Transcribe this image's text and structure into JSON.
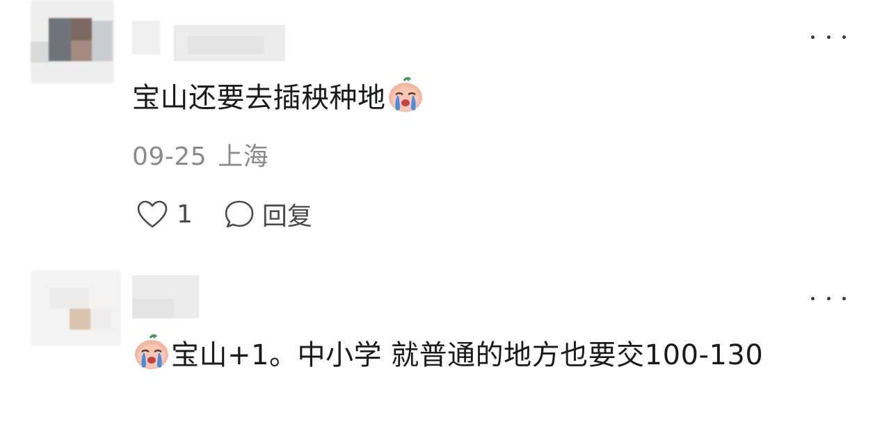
{
  "comments": [
    {
      "content": "宝山还要去插秧种地",
      "emoji": "crying-emoji",
      "date": "09-25",
      "location": "上海",
      "like_count": "1",
      "reply_label": "回复"
    },
    {
      "content": "宝山+1。中小学 就普通的地方也要交100-130",
      "emoji": "crying-emoji"
    }
  ],
  "colors": {
    "text": "#1a1a1a",
    "meta": "#8a8a8a",
    "icon": "#4a4a4a"
  }
}
